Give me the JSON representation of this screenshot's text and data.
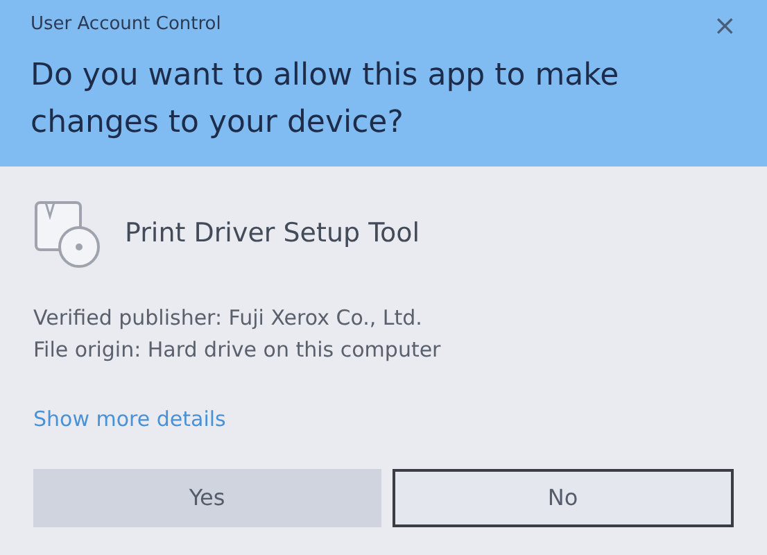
{
  "window": {
    "title": "User Account Control",
    "close": "×"
  },
  "question": "Do you want to allow this app to make changes to your device?",
  "app": {
    "name": "Print Driver Setup Tool"
  },
  "details": [
    "Verified publisher: Fuji Xerox Co., Ltd.",
    "File origin: Hard drive on this computer"
  ],
  "more_link": "Show more details",
  "buttons": [
    {
      "label": "Yes",
      "focused": false
    },
    {
      "label": "No",
      "focused": true
    }
  ]
}
